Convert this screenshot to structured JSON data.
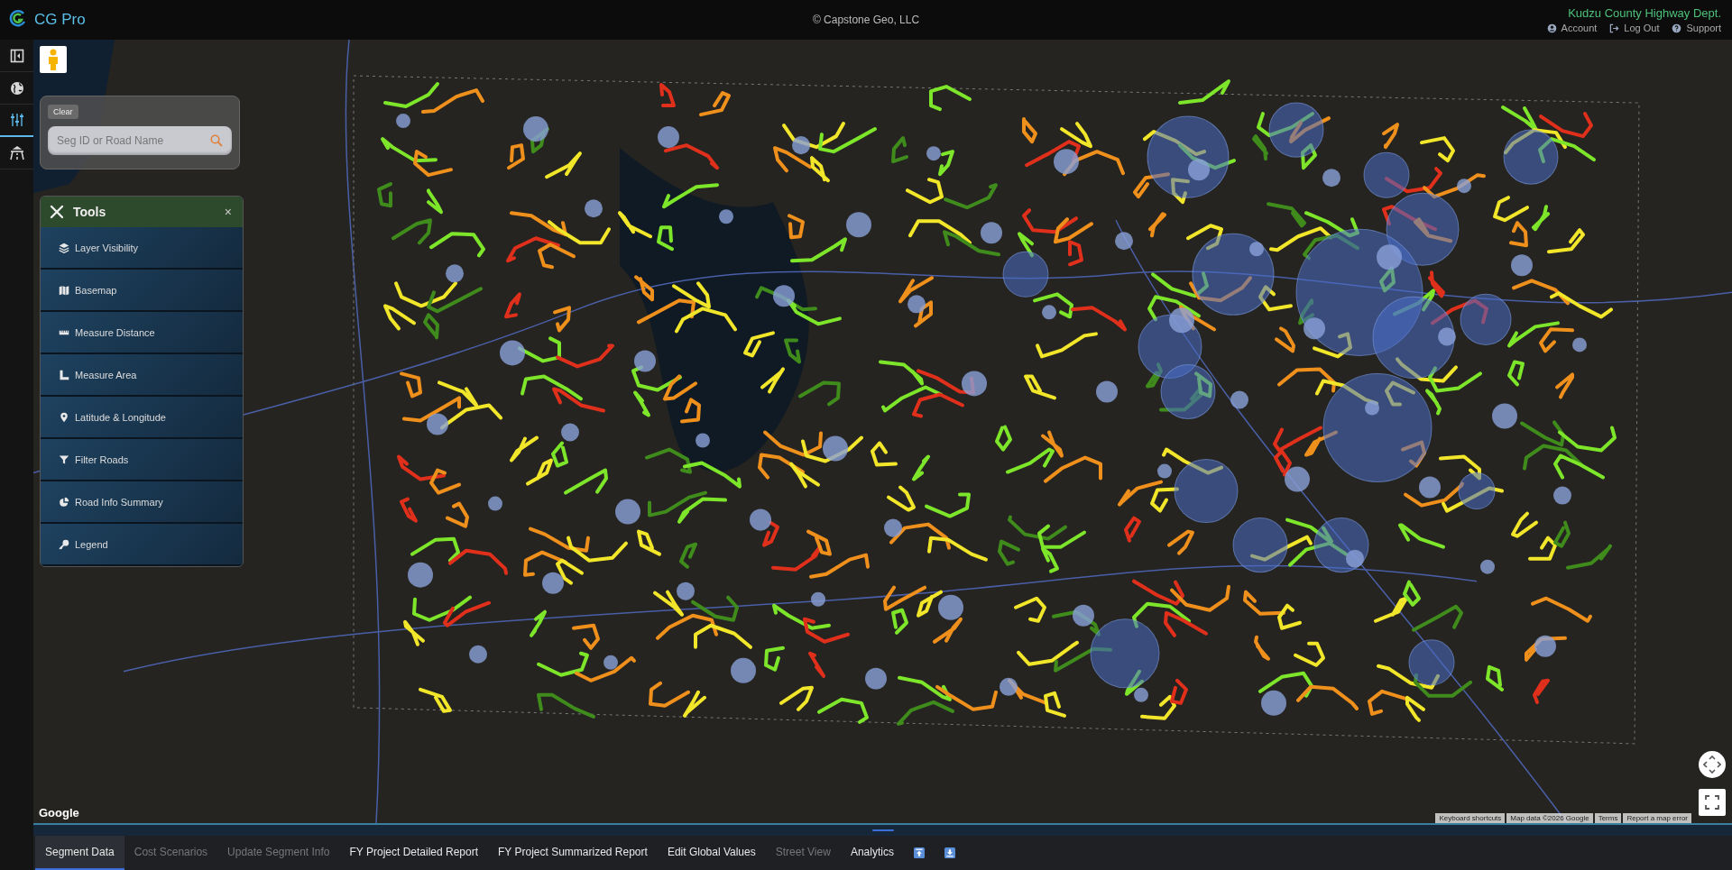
{
  "app": {
    "title": "CG Pro",
    "copyright": "© Capstone Geo, LLC",
    "organization": "Kudzu County Highway Dept.",
    "user_links": [
      {
        "label": "Account",
        "kind": "user"
      },
      {
        "label": "Log Out",
        "kind": "logout"
      },
      {
        "label": "Support",
        "kind": "help"
      }
    ]
  },
  "rail": [
    {
      "kind": "panel",
      "selected": false
    },
    {
      "kind": "globe",
      "selected": false
    },
    {
      "kind": "sliders",
      "selected": true
    },
    {
      "kind": "road",
      "selected": false
    }
  ],
  "search": {
    "clear_label": "Clear",
    "placeholder": "Seg ID or Road Name"
  },
  "tools": {
    "title": "Tools",
    "close": "×",
    "items": [
      {
        "label": "Layer Visibility",
        "kind": "layers"
      },
      {
        "label": "Basemap",
        "kind": "map"
      },
      {
        "label": "Measure Distance",
        "kind": "ruler"
      },
      {
        "label": "Measure Area",
        "kind": "area"
      },
      {
        "label": "Latitude & Longitude",
        "kind": "pin"
      },
      {
        "label": "Filter Roads",
        "kind": "filter"
      },
      {
        "label": "Road Info Summary",
        "kind": "pie"
      },
      {
        "label": "Legend",
        "kind": "key"
      }
    ]
  },
  "map_attribution": {
    "logo": "Google",
    "links": [
      "Keyboard shortcuts",
      "Map data ©2026 Google",
      "Terms",
      "Report a map error"
    ]
  },
  "bottom_tabs": [
    {
      "label": "Segment Data",
      "selected": true,
      "disabled": false
    },
    {
      "label": "Cost Scenarios",
      "selected": false,
      "disabled": true
    },
    {
      "label": "Update Segment Info",
      "selected": false,
      "disabled": true
    },
    {
      "label": "FY Project Detailed Report",
      "selected": false,
      "disabled": false
    },
    {
      "label": "FY Project Summarized Report",
      "selected": false,
      "disabled": false
    },
    {
      "label": "Edit Global Values",
      "selected": false,
      "disabled": false
    },
    {
      "label": "Street View",
      "selected": false,
      "disabled": true
    },
    {
      "label": "Analytics",
      "selected": false,
      "disabled": false
    }
  ],
  "tab_actions": [
    {
      "kind": "up"
    },
    {
      "kind": "down"
    }
  ]
}
